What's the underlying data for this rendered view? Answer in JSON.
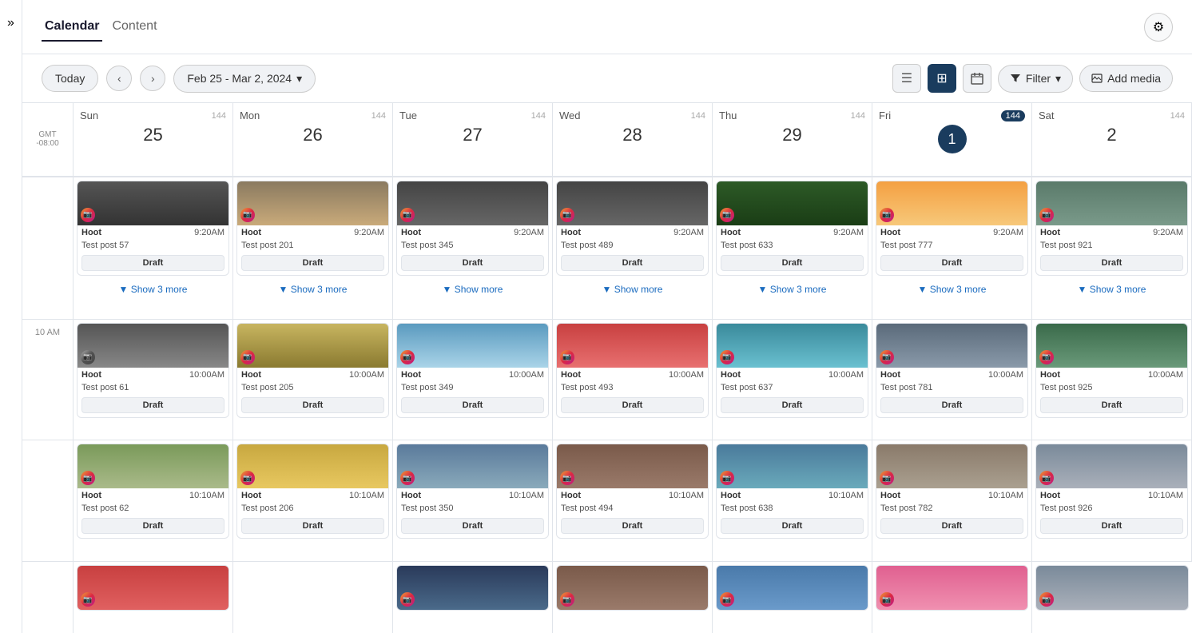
{
  "app": {
    "tabs": [
      {
        "label": "Calendar",
        "active": true
      },
      {
        "label": "Content",
        "active": false
      }
    ],
    "gear_icon": "⚙"
  },
  "toolbar": {
    "today_label": "Today",
    "prev_icon": "‹",
    "next_icon": "›",
    "date_range": "Feb 25 - Mar 2, 2024",
    "dropdown_icon": "▾",
    "list_view_icon": "☰",
    "grid_view_icon": "⊞",
    "calendar_view_icon": "📅",
    "filter_label": "Filter",
    "filter_icon": "▾",
    "add_media_label": "Add media",
    "add_media_icon": "🖼"
  },
  "calendar": {
    "gmt": "GMT",
    "gmt_offset": "-08:00",
    "days": [
      {
        "name": "Sun",
        "date": 25,
        "count": 144,
        "is_today": false
      },
      {
        "name": "Mon",
        "date": 26,
        "count": 144,
        "is_today": false
      },
      {
        "name": "Tue",
        "date": 27,
        "count": 144,
        "is_today": false
      },
      {
        "name": "Wed",
        "date": 28,
        "count": 144,
        "is_today": false
      },
      {
        "name": "Thu",
        "date": 29,
        "count": 144,
        "is_today": false
      },
      {
        "name": "Fri",
        "date": 1,
        "count": 144,
        "is_today": true
      },
      {
        "name": "Sat",
        "date": 2,
        "count": 144,
        "is_today": false
      }
    ],
    "time_10am": "10 AM",
    "rows": [
      {
        "time": "",
        "cells": [
          {
            "name": "Hoot",
            "time": "9:20AM",
            "title": "Test post 57",
            "status": "Draft",
            "show_more": "Show 3 more",
            "img_class": "img-city"
          },
          {
            "name": "Hoot",
            "time": "9:20AM",
            "title": "Test post 201",
            "status": "Draft",
            "show_more": "Show 3 more",
            "img_class": "img-laptop"
          },
          {
            "name": "Hoot",
            "time": "9:20AM",
            "title": "Test post 345",
            "status": "Draft",
            "show_more": "Show more",
            "img_class": "img-screen"
          },
          {
            "name": "Hoot",
            "time": "9:20AM",
            "title": "Test post 489",
            "status": "Draft",
            "show_more": "Show more",
            "img_class": "img-screen"
          },
          {
            "name": "Hoot",
            "time": "9:20AM",
            "title": "Test post 633",
            "status": "Draft",
            "show_more": "Show 3 more",
            "img_class": "img-forest"
          },
          {
            "name": "Hoot",
            "time": "9:20AM",
            "title": "Test post 777",
            "status": "Draft",
            "show_more": "Show 3 more",
            "img_class": "img-sunny"
          },
          {
            "name": "Hoot",
            "time": "9:20AM",
            "title": "Test post 921",
            "status": "Draft",
            "show_more": "Show 3 more",
            "img_class": "img-river"
          }
        ]
      },
      {
        "time": "10 AM",
        "cells": [
          {
            "name": "Hoot",
            "time": "10:00AM",
            "title": "Test post 61",
            "status": "Draft",
            "img_class": "img-bw-city"
          },
          {
            "name": "Hoot",
            "time": "10:00AM",
            "title": "Test post 205",
            "status": "Draft",
            "img_class": "img-field"
          },
          {
            "name": "Hoot",
            "time": "10:00AM",
            "title": "Test post 349",
            "status": "Draft",
            "img_class": "img-beach"
          },
          {
            "name": "Hoot",
            "time": "10:00AM",
            "title": "Test post 493",
            "status": "Draft",
            "img_class": "img-pizza"
          },
          {
            "name": "Hoot",
            "time": "10:00AM",
            "title": "Test post 637",
            "status": "Draft",
            "img_class": "img-pool"
          },
          {
            "name": "Hoot",
            "time": "10:00AM",
            "title": "Test post 781",
            "status": "Draft",
            "img_class": "img-cabin"
          },
          {
            "name": "Hoot",
            "time": "10:00AM",
            "title": "Test post 925",
            "status": "Draft",
            "img_class": "img-trees"
          }
        ]
      },
      {
        "time": "",
        "cells": [
          {
            "name": "Hoot",
            "time": "10:10AM",
            "title": "Test post 62",
            "status": "Draft",
            "img_class": "img-hills"
          },
          {
            "name": "Hoot",
            "time": "10:10AM",
            "title": "Test post 206",
            "status": "Draft",
            "img_class": "img-house"
          },
          {
            "name": "Hoot",
            "time": "10:10AM",
            "title": "Test post 350",
            "status": "Draft",
            "img_class": "img-coast"
          },
          {
            "name": "Hoot",
            "time": "10:10AM",
            "title": "Test post 494",
            "status": "Draft",
            "img_class": "img-bricks"
          },
          {
            "name": "Hoot",
            "time": "10:10AM",
            "title": "Test post 638",
            "status": "Draft",
            "img_class": "img-lake"
          },
          {
            "name": "Hoot",
            "time": "10:10AM",
            "title": "Test post 782",
            "status": "Draft",
            "img_class": "img-outdoor"
          },
          {
            "name": "Hoot",
            "time": "10:10AM",
            "title": "Test post 926",
            "status": "Draft",
            "img_class": "img-mountain"
          }
        ]
      },
      {
        "time": "",
        "cells": [
          {
            "img_class": "img-coffee"
          },
          {
            "img_class": ""
          },
          {
            "img_class": "img-lights"
          },
          {
            "img_class": "img-bricks"
          },
          {
            "img_class": "img-ferris"
          },
          {
            "img_class": "img-pink"
          },
          {
            "img_class": "img-mountain"
          }
        ]
      }
    ]
  }
}
